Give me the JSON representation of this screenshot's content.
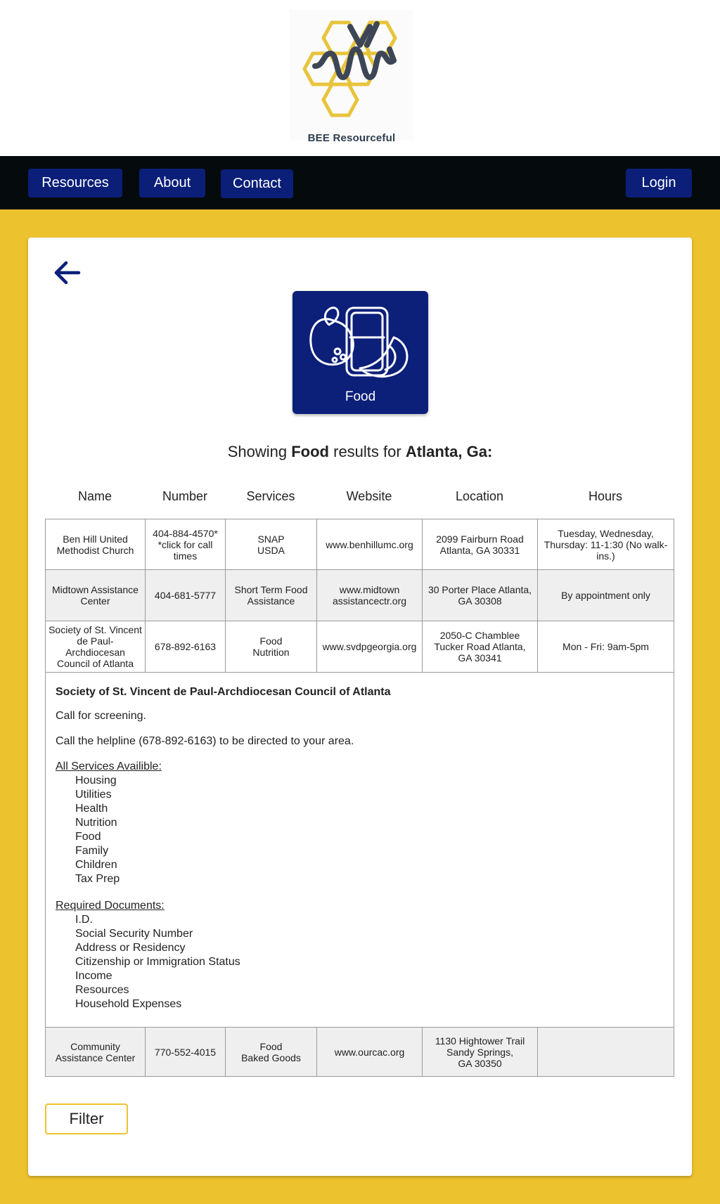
{
  "brand": {
    "name": "BEE Resourceful",
    "colors": {
      "navy": "#0b1f78",
      "yellow": "#edc22f",
      "slate": "#2e3d4f",
      "nav_bg": "#050b0d"
    }
  },
  "nav": {
    "resources": "Resources",
    "about": "About",
    "contact": "Contact",
    "login": "Login"
  },
  "back_icon": "arrow-left-icon",
  "category": {
    "label": "Food",
    "icon": "food-icon"
  },
  "heading": {
    "prefix": "Showing ",
    "category": "Food",
    "middle": " results for ",
    "location": "Atlanta, Ga:"
  },
  "table": {
    "headers": [
      "Name",
      "Number",
      "Services",
      "Website",
      "Location",
      "Hours"
    ],
    "rows": [
      {
        "name": "Ben Hill United Methodist Church",
        "number": "404-884-4570* *click for call times",
        "services": [
          "SNAP",
          "USDA"
        ],
        "website": "www.benhillumc.org",
        "location": [
          "2099 Fairburn Road",
          "Atlanta, GA 30331"
        ],
        "hours": "Tuesday, Wednesday, Thursday: 11-1:30 (No walk-ins.)"
      },
      {
        "name": "Midtown Assistance Center",
        "number": "404-681-5777",
        "services": [
          "Short Term Food",
          "Assistance"
        ],
        "website": [
          "www.midtown",
          "assistancectr.org"
        ],
        "location": [
          "30 Porter Place Atlanta,",
          "GA 30308"
        ],
        "hours": "By appointment only"
      },
      {
        "name": "Society of St. Vincent de Paul-Archdiocesan Council of Atlanta",
        "number": "678-892-6163",
        "services": [
          "Food",
          "Nutrition"
        ],
        "website": "www.svdpgeorgia.org",
        "location": [
          "2050-C Chamblee",
          "Tucker Road Atlanta,",
          "GA 30341"
        ],
        "hours": "Mon - Fri: 9am-5pm"
      },
      {
        "name": "Community Assistance Center",
        "number": "770-552-4015",
        "services": [
          "Food",
          "Baked Goods"
        ],
        "website": "www.ourcac.org",
        "location": [
          "1130 Hightower Trail",
          "Sandy Springs,",
          "GA 30350"
        ],
        "hours": ""
      }
    ],
    "detail": {
      "title": "Society of St. Vincent de Paul-Archdiocesan Council of Atlanta",
      "line1": "Call for screening.",
      "line2": "Call the helpline (678-892-6163) to be directed to your area.",
      "services_heading": "All Services Availible:",
      "services": [
        "Housing",
        "Utilities",
        "Health",
        "Nutrition",
        "Food",
        "Family",
        "Children",
        "Tax Prep"
      ],
      "documents_heading": "Required Documents:",
      "documents": [
        "I.D.",
        "Social Security Number",
        "Address or Residency",
        "Citizenship or Immigration Status",
        "Income",
        "Resources",
        "Household Expenses"
      ]
    }
  },
  "filter_label": "Filter"
}
